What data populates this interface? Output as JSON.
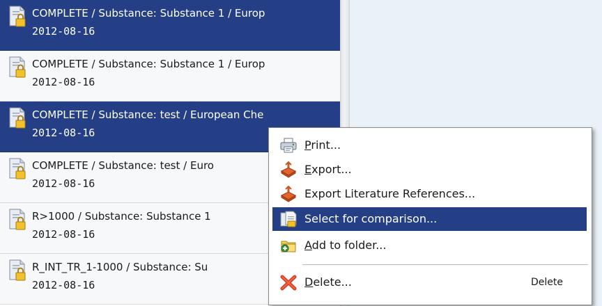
{
  "list": {
    "items": [
      {
        "title": "COMPLETE / Substance: Substance 1 / Europ",
        "date": "2012-08-16",
        "selected": true
      },
      {
        "title": "COMPLETE / Substance: Substance 1 / Europ",
        "date": "2012-08-16",
        "selected": false
      },
      {
        "title": "COMPLETE / Substance: test / European Che",
        "date": "2012-08-16",
        "selected": true
      },
      {
        "title": "COMPLETE / Substance: test / Euro",
        "date": "2012-08-16",
        "selected": false
      },
      {
        "title": "R>1000 / Substance: Substance 1",
        "date": "2012-08-16",
        "selected": false
      },
      {
        "title": "R_INT_TR_1-1000 / Substance: Su",
        "date": "2012-08-16",
        "selected": false
      }
    ]
  },
  "context_menu": {
    "items": [
      {
        "label": "Print...",
        "mnemonic": "P",
        "icon": "printer-icon"
      },
      {
        "label": "Export...",
        "mnemonic": "E",
        "icon": "export-icon"
      },
      {
        "label": "Export Literature References...",
        "icon": "export-references-icon"
      },
      {
        "label": "Select for comparison...",
        "icon": "compare-icon",
        "highlighted": true
      },
      {
        "label": "Add to folder...",
        "mnemonic": "A",
        "icon": "add-to-folder-icon"
      },
      {
        "label": "Delete...",
        "mnemonic": "D",
        "icon": "delete-icon",
        "shortcut": "Delete"
      }
    ]
  },
  "colors": {
    "selection": "#253f86",
    "right_panel_bg": "#eaf1f8"
  }
}
